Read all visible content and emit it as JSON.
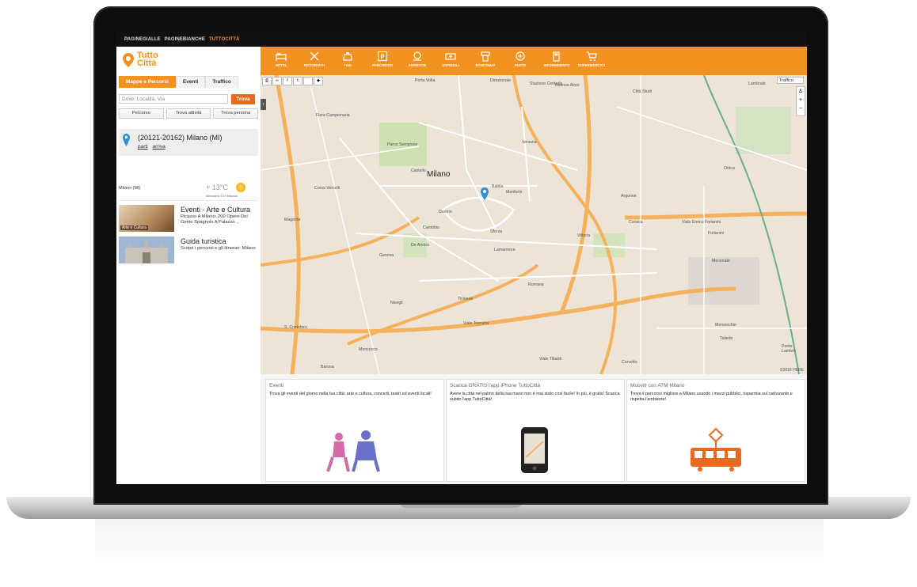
{
  "topbar": {
    "links": [
      "PAGINEGIALLE",
      "PAGINEBIANCHE",
      "TUTTOCITTÀ"
    ],
    "active_index": 2
  },
  "logo": {
    "line1": "Tutto",
    "line2": "Città"
  },
  "sidebar": {
    "tabs": [
      "Mappe e Percorsi",
      "Eventi",
      "Traffico"
    ],
    "search": {
      "placeholder": "Dove: Località, Via",
      "button": "Trova"
    },
    "modes": [
      "Percorso",
      "Trova attività",
      "Trova persona"
    ],
    "location": {
      "title": "(20121-20162) Milano (MI)",
      "link_from": "parti",
      "link_to": "arriva"
    },
    "weather": {
      "city": "Milano (MI)",
      "temp": "+ 13°C",
      "date": "Mercoledì 13 Febbraio"
    },
    "promos": [
      {
        "title": "Eventi - Arte e Cultura",
        "desc": "Picasso A Milano: 200 Opere Del Genio Spagnolo A Palazzo ...",
        "thumb_label": "Arte e Cultura"
      },
      {
        "title": "Guida turistica",
        "desc": "Scopri i percorsi e gli itinerari: Milano",
        "thumb_label": ""
      }
    ]
  },
  "menubar": {
    "items": [
      {
        "label": "HOTEL",
        "icon": "bed-icon"
      },
      {
        "label": "RISTORANTI",
        "icon": "cutlery-icon"
      },
      {
        "label": "TAXI",
        "icon": "taxi-icon"
      },
      {
        "label": "PARCHEGGI",
        "icon": "parking-icon"
      },
      {
        "label": "FARMACIE",
        "icon": "pharmacy-icon"
      },
      {
        "label": "OSPEDALI",
        "icon": "ambulance-icon"
      },
      {
        "label": "BANCOMAT",
        "icon": "atm-icon"
      },
      {
        "label": "POSTE",
        "icon": "mail-icon"
      },
      {
        "label": "RIFORNIMENTO",
        "icon": "fuel-icon"
      },
      {
        "label": "SUPERMERCATI",
        "icon": "cart-icon"
      }
    ]
  },
  "map": {
    "traffic_button": "Traffico",
    "city": "Milano",
    "copyright": "©2016 HERE",
    "labels": [
      "Porta Volta",
      "Direzionale",
      "Stazione Centrale",
      "Buenos Aires",
      "Lambrate",
      "Città Studi",
      "Fiera Campionaria",
      "Parco Sempione",
      "Venezia",
      "Castello",
      "Ortica",
      "Corso Vercelli",
      "Duomo",
      "Babila",
      "Monforte",
      "Magenta",
      "Carobbio",
      "Sforza",
      "Argonne",
      "Corsica",
      "Forlanini",
      "Lamarmora",
      "De Amicis",
      "Genova",
      "Vittoria",
      "Mecenate",
      "Romana",
      "Navigli",
      "Ticinese",
      "S. Cristoforo",
      "Morsenchio",
      "Taliedo",
      "Ponte Lambro",
      "Moncucco",
      "Barona",
      "Corvetto",
      "Viale Tibaldi",
      "Viale Toscana",
      "Viale Enrico Forlanini"
    ]
  },
  "cards": [
    {
      "title": "Eventi",
      "text": "Trova gli eventi del giorno nella tua città: arte e cultura, concerti, teatri ed eventi locali!",
      "art": "concert-illustration"
    },
    {
      "title": "Scarica GRATIS l'app iPhone TuttoCittà",
      "text": "Avere la città nel palmo della tua mano non è mai stato così facile! In più, è gratis! Scarica subito l'app TuttoCittà!",
      "art": "phone-illustration"
    },
    {
      "title": "Muoviti con ATM Milano",
      "text": "Trova il percorso migliore a Milano usando i mezzi pubblici, risparmia sul carburante e rispetta l'ambiente!",
      "art": "tram-illustration"
    }
  ],
  "colors": {
    "accent": "#f39221",
    "button": "#e96a1e",
    "bezel": "#0d0d0d"
  }
}
